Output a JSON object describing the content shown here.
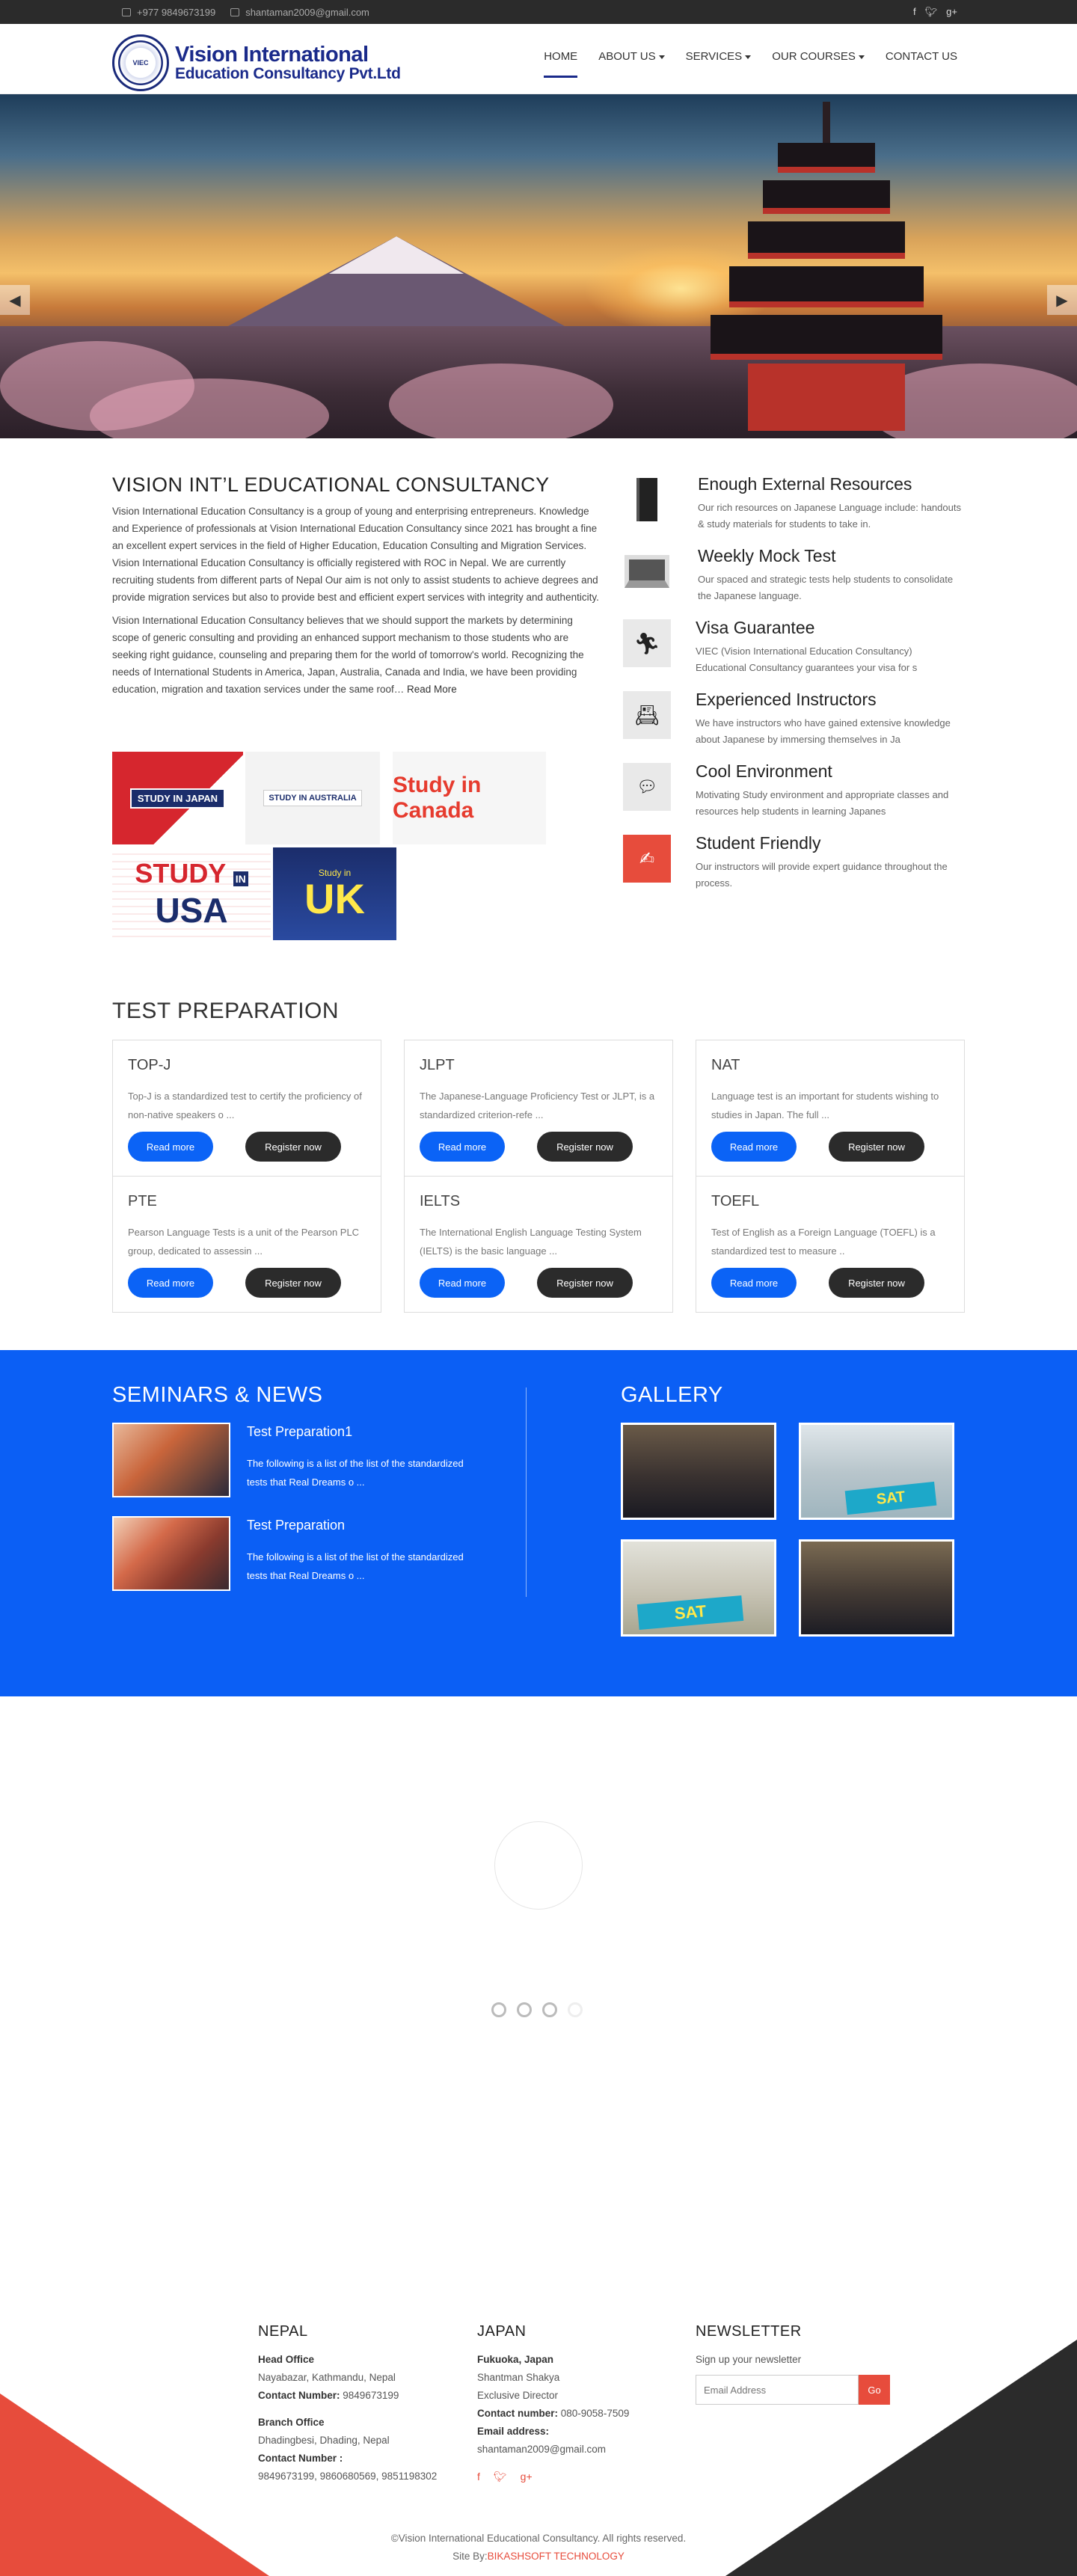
{
  "topbar": {
    "phone": "+977 9849673199",
    "email": "shantaman2009@gmail.com",
    "social_icons": [
      "facebook-icon",
      "twitter-icon",
      "google-plus-icon"
    ]
  },
  "header": {
    "logo_line1": "Vision International",
    "logo_line2": "Education Consultancy Pvt.Ltd",
    "nav": [
      {
        "label": "HOME",
        "active": true,
        "dropdown": false
      },
      {
        "label": "ABOUT US",
        "active": false,
        "dropdown": true
      },
      {
        "label": "SERVICES",
        "active": false,
        "dropdown": true
      },
      {
        "label": "OUR COURSES",
        "active": false,
        "dropdown": true
      },
      {
        "label": "CONTACT US",
        "active": false,
        "dropdown": false
      }
    ]
  },
  "hero": {
    "prev_icon": "chevron-left-icon",
    "next_icon": "chevron-right-icon"
  },
  "about": {
    "title": "VISION INT’L EDUCATIONAL CONSULTANCY",
    "para1": "Vision International Education Consultancy is a group of young and enterprising entrepreneurs. Knowledge and Experience of professionals at Vision International Education Consultancy since 2021 has brought a fine an excellent expert services in the field of Higher Education, Education Consulting and Migration Services. Vision International Education Consultancy is officially registered with ROC in Nepal. We are currently recruiting students from different parts of Nepal Our aim is not only to assist students to achieve degrees and provide migration services but also to provide best and efficient expert services with integrity and authenticity.",
    "para2": "Vision International Education Consultancy believes that we should support the markets by determining scope of generic consulting and providing an enhanced support mechanism to those students who are seeking right guidance, counseling and preparing them for the world of tomorrow's world. Recognizing the needs of International Students in America, Japan, Australia, Canada and India, we have been providing education, migration and taxation services under the same roof…",
    "read_more": "Read More",
    "flags": {
      "japan": "STUDY IN JAPAN",
      "australia": "STUDY IN AUSTRALIA",
      "canada": "Study in Canada",
      "usa_top": "STUDY",
      "usa_in": "IN",
      "usa": "USA",
      "uk_small": "Study in",
      "uk": "UK"
    }
  },
  "features": [
    {
      "icon": "book-icon",
      "title": "Enough External Resources",
      "text": "Our rich resources on Japanese Language include: handouts & study materials for students to take in."
    },
    {
      "icon": "laptop-icon",
      "title": "Weekly Mock Test",
      "text": "Our spaced and strategic tests help students to consolidate the Japanese language."
    },
    {
      "icon": "running-person-icon",
      "title": "Visa Guarantee",
      "text": "VIEC (Vision International Education Consultancy) Educational Consultancy guarantees your visa for s"
    },
    {
      "icon": "id-card-icon",
      "title": "Experienced Instructors",
      "text": "We have instructors who have gained extensive knowledge about Japanese by immersing themselves in Ja"
    },
    {
      "icon": "translate-chat-icon",
      "title": "Cool Environment",
      "text": "Motivating Study environment and appropriate classes and resources help students in learning Japanes"
    },
    {
      "icon": "handshake-icon",
      "title": "Student Friendly",
      "text": "Our instructors will provide expert guidance throughout the process."
    }
  ],
  "test_prep": {
    "title": "TEST PREPARATION",
    "read_more": "Read more",
    "register": "Register now",
    "cards": [
      {
        "title": "TOP-J",
        "desc": "Top-J is a standardized test to certify the proficiency of non-native speakers o ..."
      },
      {
        "title": "JLPT",
        "desc": "The Japanese-Language Proficiency Test or JLPT, is a standardized criterion-refe ..."
      },
      {
        "title": "NAT",
        "desc": "Language test is an important for students wishing to studies in Japan. The full ..."
      },
      {
        "title": "PTE",
        "desc": "Pearson Language Tests is a unit of the Pearson PLC group, dedicated to assessin ..."
      },
      {
        "title": "IELTS",
        "desc": "The International English Language Testing System (IELTS) is the basic language ..."
      },
      {
        "title": "TOEFL",
        "desc": "Test of English as a Foreign Language (TOEFL) is a standardized test to measure .."
      }
    ]
  },
  "seminars": {
    "title": "SEMINARS & NEWS",
    "items": [
      {
        "title": "Test Preparation1",
        "desc": "The following is a list of the list of the standardized tests that Real Dreams o ..."
      },
      {
        "title": "Test Preparation",
        "desc": "The following is a list of the list of the standardized tests that Real Dreams o ..."
      }
    ]
  },
  "gallery": {
    "title": "GALLERY",
    "sat_label": "SAT"
  },
  "footer": {
    "nepal": {
      "title": "NEPAL",
      "head_label": "Head Office",
      "head_addr": "Nayabazar, Kathmandu, Nepal",
      "contact_label": "Contact Number:",
      "head_phone": "9849673199",
      "branch_label": "Branch Office",
      "branch_addr": "Dhadingbesi, Dhading, Nepal",
      "branch_contact_label": "Contact Number :",
      "branch_phones": "9849673199, 9860680569, 9851198302"
    },
    "japan": {
      "title": "JAPAN",
      "city": "Fukuoka, Japan",
      "person": "Shantman Shakya",
      "role": "Exclusive Director",
      "contact_label": "Contact number:",
      "phone": "080-9058-7509",
      "email_label": "Email address:",
      "email": "shantaman2009@gmail.com"
    },
    "newsletter": {
      "title": "NEWSLETTER",
      "text": "Sign up your newsletter",
      "placeholder": "Email Address",
      "button": "Go"
    },
    "copyright": "©Vision International Educational Consultancy. All rights reserved.",
    "site_by_label": "Site By:",
    "developer": "BIKASHSOFT TECHNOLOGY"
  },
  "colors": {
    "brand_blue": "#0b5ff5",
    "accent_red": "#e74c3c",
    "dark": "#2b2b2b",
    "logo_navy": "#1a2a8a"
  }
}
